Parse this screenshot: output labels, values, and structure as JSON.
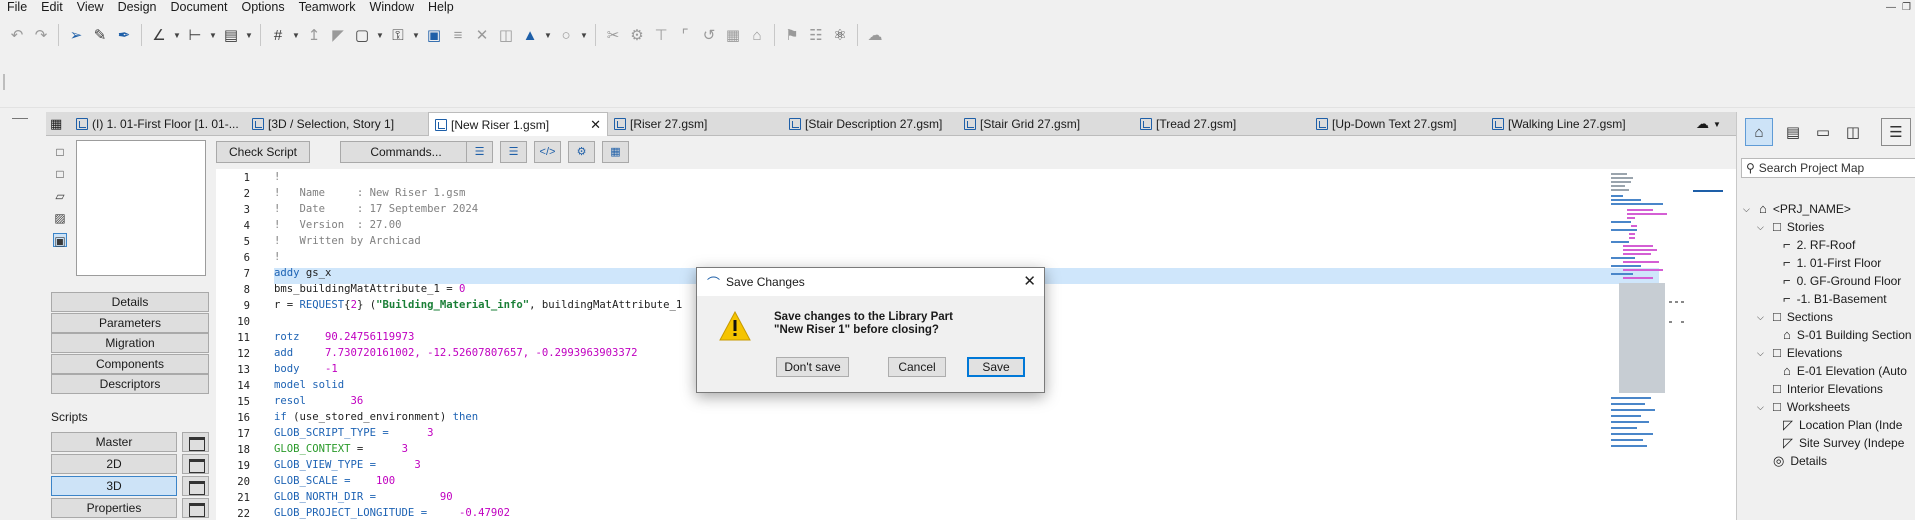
{
  "menu": [
    "File",
    "Edit",
    "View",
    "Design",
    "Document",
    "Options",
    "Teamwork",
    "Window",
    "Help"
  ],
  "tabs": [
    {
      "label": "(I) 1. 01-First Floor [1. 01-...",
      "active": false
    },
    {
      "label": "[3D / Selection, Story 1]",
      "active": false
    },
    {
      "label": "[New Riser 1.gsm]",
      "active": true
    },
    {
      "label": "[Riser 27.gsm]",
      "active": false
    },
    {
      "label": "[Stair Description 27.gsm]",
      "active": false
    },
    {
      "label": "[Stair Grid 27.gsm]",
      "active": false
    },
    {
      "label": "[Tread 27.gsm]",
      "active": false
    },
    {
      "label": "[Up-Down Text 27.gsm]",
      "active": false
    },
    {
      "label": "[Walking Line 27.gsm]",
      "active": false
    }
  ],
  "left_panel": {
    "sections": [
      "Details",
      "Parameters",
      "Migration",
      "Components",
      "Descriptors"
    ],
    "scripts_label": "Scripts",
    "scripts": [
      {
        "label": "Master",
        "selected": false
      },
      {
        "label": "2D",
        "selected": false
      },
      {
        "label": "3D",
        "selected": true
      },
      {
        "label": "Properties",
        "selected": false
      }
    ]
  },
  "editor_toolbar": {
    "check_script": "Check Script",
    "commands": "Commands..."
  },
  "code": {
    "line_numbers": [
      "1",
      "2",
      "3",
      "4",
      "5",
      "6",
      "7",
      "8",
      "9",
      "10",
      "11",
      "12",
      "13",
      "14",
      "15",
      "16",
      "17",
      "18",
      "19",
      "20",
      "21",
      "22"
    ],
    "lines": [
      [
        {
          "t": "!",
          "c": "com"
        }
      ],
      [
        {
          "t": "!   Name     : New Riser 1.gsm",
          "c": "com"
        }
      ],
      [
        {
          "t": "!   Date     : 17 September 2024",
          "c": "com"
        }
      ],
      [
        {
          "t": "!   Version  : 27.00",
          "c": "com"
        }
      ],
      [
        {
          "t": "!   Written by Archicad",
          "c": "com"
        }
      ],
      [
        {
          "t": "!",
          "c": "com"
        }
      ],
      [
        {
          "t": "addy ",
          "c": "kw"
        },
        {
          "t": "gs_x",
          "c": "txt"
        }
      ],
      [
        {
          "t": "bms_buildingMatAttribute_1 = ",
          "c": "txt"
        },
        {
          "t": "0",
          "c": "num"
        }
      ],
      [
        {
          "t": "r = ",
          "c": "txt"
        },
        {
          "t": "REQUEST",
          "c": "kw"
        },
        {
          "t": "{",
          "c": "txt"
        },
        {
          "t": "2",
          "c": "num"
        },
        {
          "t": "} (",
          "c": "txt"
        },
        {
          "t": "\"Building_Material_info\"",
          "c": "str"
        },
        {
          "t": ", buildingMatAttribute_1",
          "c": "txt"
        }
      ],
      [],
      [
        {
          "t": "rotz    ",
          "c": "kw"
        },
        {
          "t": "90.24756119973",
          "c": "num"
        }
      ],
      [
        {
          "t": "add     ",
          "c": "kw"
        },
        {
          "t": "7.730720161002, -12.52607807657, -0.2993963903372",
          "c": "num"
        }
      ],
      [
        {
          "t": "body    ",
          "c": "kw"
        },
        {
          "t": "-1",
          "c": "num"
        }
      ],
      [
        {
          "t": "model solid",
          "c": "kw"
        }
      ],
      [
        {
          "t": "resol       ",
          "c": "kw"
        },
        {
          "t": "36",
          "c": "num"
        }
      ],
      [
        {
          "t": "if ",
          "c": "kw"
        },
        {
          "t": "(use_stored_environment) ",
          "c": "txt"
        },
        {
          "t": "then",
          "c": "kw"
        }
      ],
      [
        {
          "t": "GLOB_SCRIPT_TYPE = ",
          "c": "kw"
        },
        {
          "t": "     3",
          "c": "num"
        }
      ],
      [
        {
          "t": "GLOB_CONTEXT",
          "c": "g"
        },
        {
          "t": " = ",
          "c": "txt"
        },
        {
          "t": "     3",
          "c": "num"
        }
      ],
      [
        {
          "t": "GLOB_VIEW_TYPE = ",
          "c": "kw"
        },
        {
          "t": "     3",
          "c": "num"
        }
      ],
      [
        {
          "t": "GLOB_SCALE = ",
          "c": "kw"
        },
        {
          "t": "   100",
          "c": "num"
        }
      ],
      [
        {
          "t": "GLOB_NORTH_DIR = ",
          "c": "kw"
        },
        {
          "t": "         90",
          "c": "num"
        }
      ],
      [
        {
          "t": "GLOB_PROJECT_LONGITUDE = ",
          "c": "kw"
        },
        {
          "t": "    -0.47902",
          "c": "num"
        }
      ]
    ]
  },
  "navigator": {
    "search_placeholder": "Search Project Map",
    "tree": [
      {
        "label": "<PRJ_NAME>",
        "level": 0,
        "expanded": true,
        "icon": "project-icon"
      },
      {
        "label": "Stories",
        "level": 1,
        "expanded": true,
        "icon": "folder-icon"
      },
      {
        "label": "2. RF-Roof",
        "level": 2,
        "icon": "story-icon"
      },
      {
        "label": "1. 01-First Floor",
        "level": 2,
        "icon": "story-icon"
      },
      {
        "label": "0. GF-Ground Floor",
        "level": 2,
        "icon": "story-icon"
      },
      {
        "label": "-1. B1-Basement",
        "level": 2,
        "icon": "story-icon"
      },
      {
        "label": "Sections",
        "level": 1,
        "expanded": true,
        "icon": "folder-icon"
      },
      {
        "label": "S-01 Building Section",
        "level": 2,
        "icon": "section-icon"
      },
      {
        "label": "Elevations",
        "level": 1,
        "expanded": true,
        "icon": "folder-icon"
      },
      {
        "label": "E-01 Elevation (Auto",
        "level": 2,
        "icon": "elevation-icon"
      },
      {
        "label": "Interior Elevations",
        "level": 1,
        "icon": "folder-icon"
      },
      {
        "label": "Worksheets",
        "level": 1,
        "expanded": true,
        "icon": "folder-icon"
      },
      {
        "label": "Location Plan (Inde",
        "level": 2,
        "icon": "worksheet-icon"
      },
      {
        "label": "Site Survey (Indepe",
        "level": 2,
        "icon": "worksheet-icon"
      },
      {
        "label": "Details",
        "level": 1,
        "icon": "detail-icon"
      }
    ]
  },
  "dialog": {
    "title": "Save Changes",
    "message_line1": "Save changes to the Library Part",
    "message_line2": "\"New Riser 1\" before closing?",
    "dont_save": "Don't save",
    "cancel": "Cancel",
    "save": "Save"
  },
  "colors": {
    "accent": "#0078d7",
    "keyword": "#1e63b4",
    "number": "#c000c0",
    "comment": "#808080",
    "highlight": "#cfe6fb",
    "warning": "#f5c400"
  }
}
